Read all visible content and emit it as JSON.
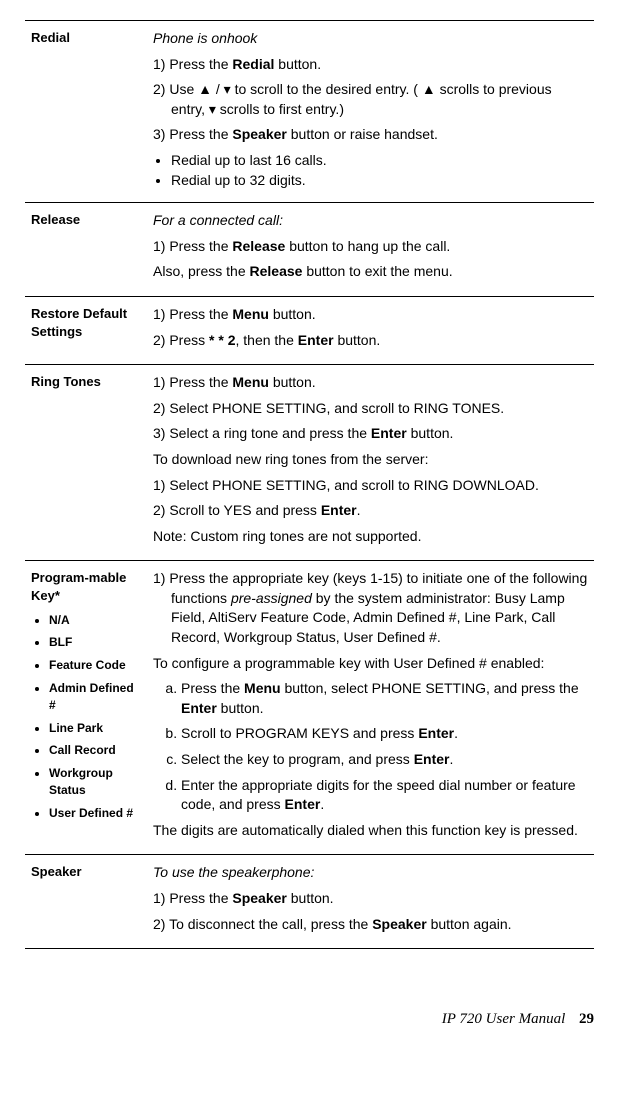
{
  "rows": {
    "redial": {
      "title": "Redial",
      "state": "Phone is onhook",
      "s1_a": "1) Press the ",
      "s1_b": "Redial",
      "s1_c": " button.",
      "s2": "2) Use ▲ / ▾ to scroll to the desired entry. ( ▲ scrolls to previous entry, ▾ scrolls to first entry.)",
      "s3_a": "3) Press the ",
      "s3_b": "Speaker",
      "s3_c": " button or raise handset.",
      "b1": "Redial up to last 16 calls.",
      "b2": "Redial up to 32 digits."
    },
    "release": {
      "title": "Release",
      "state": "For a connected call:",
      "s1_a": "1) Press the ",
      "s1_b": "Release",
      "s1_c": " button to hang up the call.",
      "s2_a": "Also, press the ",
      "s2_b": "Release",
      "s2_c": " button to exit the menu."
    },
    "restore": {
      "title": "Restore Default Settings",
      "s1_a": "1) Press the ",
      "s1_b": "Menu",
      "s1_c": " button.",
      "s2_a": "2) Press ",
      "s2_b": "* * 2",
      "s2_c": ", then the ",
      "s2_d": "Enter",
      "s2_e": " button."
    },
    "ring": {
      "title": "Ring Tones",
      "s1_a": "1) Press the ",
      "s1_b": "Menu",
      "s1_c": " button.",
      "s2": "2) Select PHONE SETTING, and scroll to RING TONES.",
      "s3_a": "3) Select a ring tone and press the ",
      "s3_b": "Enter",
      "s3_c": " button.",
      "dl": "To download new ring tones from the server:",
      "d1": "1) Select PHONE SETTING, and scroll to RING DOWNLOAD.",
      "d2_a": "2) Scroll to YES and press ",
      "d2_b": "Enter",
      "d2_c": ".",
      "note": "Note: Custom ring tones are not supported."
    },
    "prog": {
      "title": "Program-mable Key*",
      "items": {
        "i1": "N/A",
        "i2": "BLF",
        "i3": "Feature Code",
        "i4": "Admin Defined #",
        "i5": "Line Park",
        "i6": "Call Record",
        "i7": "Workgroup Status",
        "i8": "User Defined #"
      },
      "intro_a": "1) Press the appropriate key (keys 1-15) to initiate one of the following functions ",
      "intro_b": "pre-assigned",
      "intro_c": " by the system administrator: Busy Lamp Field, AltiServ Feature Code, Admin Defined #, Line Park, Call Record, Workgroup Status, User Defined #.",
      "conf": "To configure a programmable key with User Defined # enabled:",
      "a_a": "Press the ",
      "a_b": "Menu",
      "a_c": " button, select PHONE SETTING, and press the ",
      "a_d": "Enter",
      "a_e": " button.",
      "b_a": "Scroll to PROGRAM KEYS and press ",
      "b_b": "Enter",
      "b_c": ".",
      "c_a": "Select the key to program, and press ",
      "c_b": "Enter",
      "c_c": ".",
      "d_a": "Enter the appropriate digits for the speed dial number or feature code, and press ",
      "d_b": "Enter",
      "d_c": ".",
      "outro": "The digits are automatically dialed when this function key is pressed."
    },
    "speaker": {
      "title": "Speaker",
      "state": "To use the speakerphone:",
      "s1_a": "1) Press the ",
      "s1_b": "Speaker",
      "s1_c": " button.",
      "s2_a": "2) To disconnect the call, press the ",
      "s2_b": "Speaker",
      "s2_c": " button again."
    }
  },
  "footer": {
    "doc": "IP 720 User Manual",
    "page": "29"
  }
}
